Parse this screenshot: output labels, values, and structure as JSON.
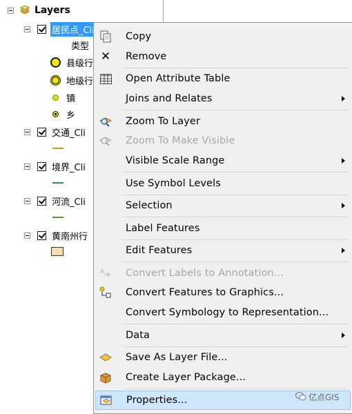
{
  "toc": {
    "root_label": "Layers",
    "layers": [
      {
        "name": "居民点_Cli",
        "selected": true,
        "legend_heading": "类型",
        "legend": [
          "县级行",
          "地级行",
          "镇",
          "乡"
        ]
      },
      {
        "name": "交通_Cli",
        "line_color": "#c8a000"
      },
      {
        "name": "境界_Cli",
        "line_color": "#2e8b57"
      },
      {
        "name": "河流_Cli",
        "line_color": "#4f9a3a"
      },
      {
        "name": "黄南州行",
        "fill_color": "#f6dcb0"
      }
    ]
  },
  "menu": {
    "items": [
      {
        "label": "Copy",
        "icon": "copy-icon"
      },
      {
        "label": "Remove",
        "icon": "remove-x-icon"
      },
      {
        "label": "Open Attribute Table",
        "icon": "table-icon"
      },
      {
        "label": "Joins and Relates",
        "submenu": true
      },
      {
        "label": "Zoom To Layer",
        "icon": "zoom-layer-icon"
      },
      {
        "label": "Zoom To Make Visible",
        "icon": "zoom-visible-icon",
        "disabled": true
      },
      {
        "label": "Visible Scale Range",
        "submenu": true
      },
      {
        "label": "Use Symbol Levels"
      },
      {
        "label": "Selection",
        "submenu": true
      },
      {
        "label": "Label Features"
      },
      {
        "label": "Edit Features",
        "submenu": true
      },
      {
        "label": "Convert Labels to Annotation...",
        "icon": "convert-labels-icon",
        "disabled": true
      },
      {
        "label": "Convert Features to Graphics...",
        "icon": "convert-graphics-icon"
      },
      {
        "label": "Convert Symbology to Representation..."
      },
      {
        "label": "Data",
        "submenu": true
      },
      {
        "label": "Save As Layer File...",
        "icon": "layer-file-icon"
      },
      {
        "label": "Create Layer Package...",
        "icon": "layer-package-icon"
      },
      {
        "label": "Properties...",
        "icon": "properties-icon",
        "highlighted": true
      }
    ]
  },
  "watermark": "亿点GIS",
  "colors": {
    "selection": "#3399ff",
    "menu_bg": "#f0f0f0",
    "highlight": "#cfe5fa"
  }
}
